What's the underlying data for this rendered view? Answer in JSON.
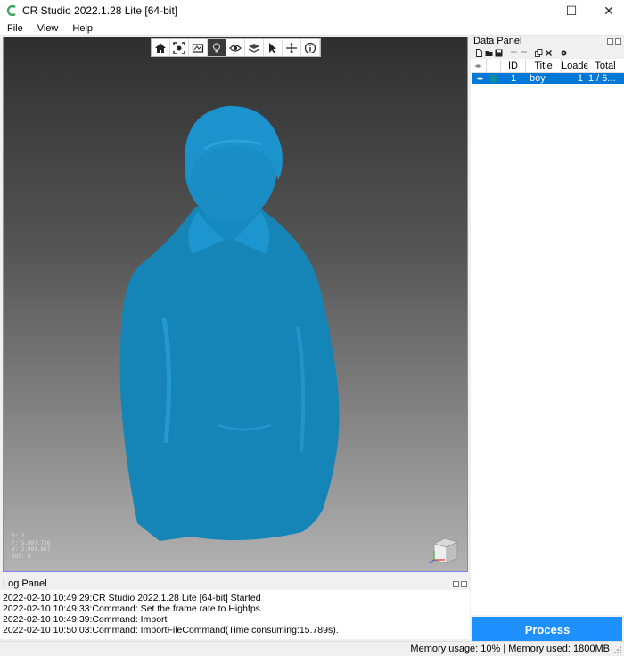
{
  "window": {
    "title": "CR Studio 2022.1.28 Lite [64-bit]",
    "minimize": "—",
    "maximize": "☐",
    "close": "✕"
  },
  "colors": {
    "accent": "#0078d7",
    "process": "#1e90ff",
    "model": "#1585b8",
    "viewport_border": "#8080ff"
  },
  "menu": {
    "items": [
      "File",
      "View",
      "Help"
    ]
  },
  "viewport": {
    "toolbar_icons": [
      "home-icon",
      "fit-view-icon",
      "frame-icon",
      "light-bulb-icon",
      "eye-icon",
      "layers-icon",
      "cursor-icon",
      "move-axis-icon",
      "info-icon"
    ],
    "active_tool": 3,
    "info_lines": [
      "B: 1",
      "F: 5.897.738",
      "V: 2.903.867",
      "Sel: 0"
    ]
  },
  "data_panel": {
    "title": "Data Panel",
    "toolbar_icons": [
      "new-file-icon",
      "open-folder-icon",
      "save-icon",
      "undo-icon",
      "redo-icon",
      "copy-icon",
      "delete-icon",
      "settings-icon"
    ],
    "columns": [
      "",
      "ID",
      "Title",
      "Loade",
      "Total"
    ],
    "rows": [
      {
        "visible_icon": "eye-icon",
        "id": "1",
        "title": "boy",
        "loaded": "1",
        "total": "1 / 6..."
      }
    ]
  },
  "log_panel": {
    "title": "Log Panel",
    "lines": [
      "2022-02-10 10:49:29:CR Studio 2022.1.28 Lite [64-bit] Started",
      "2022-02-10 10:49:33:Command: Set the frame rate to Highfps.",
      "2022-02-10 10:49:39:Command: Import",
      "2022-02-10 10:50:03:Command: ImportFileCommand(Time consuming:15.789s)."
    ]
  },
  "process_button": {
    "label": "Process"
  },
  "status": {
    "text": "Memory usage: 10% | Memory used: 1800MB"
  }
}
